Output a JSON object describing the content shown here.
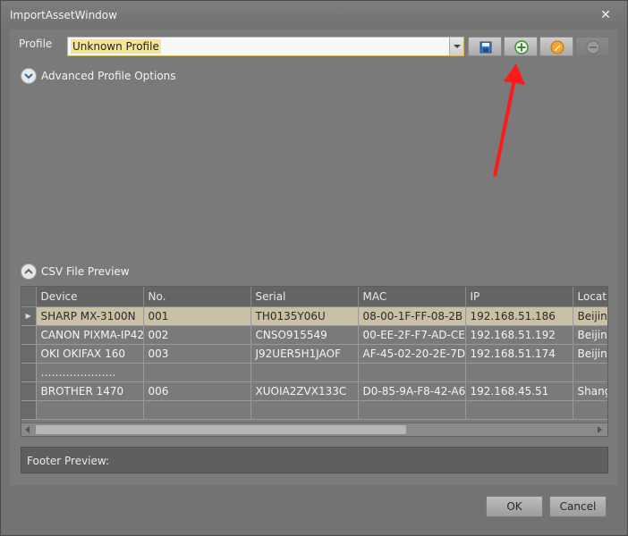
{
  "window": {
    "title": "ImportAssetWindow"
  },
  "profile": {
    "label": "Profile",
    "selected": "Unknown Profile",
    "buttons": [
      "save-icon",
      "add-icon",
      "edit-icon",
      "remove-icon"
    ]
  },
  "advanced": {
    "label": "Advanced Profile Options"
  },
  "csv": {
    "label": "CSV File Preview",
    "columns": [
      "Device",
      "No.",
      "Serial",
      "MAC",
      "IP",
      "Location"
    ],
    "rows": [
      [
        "SHARP MX-3100N",
        "001",
        "TH0135Y06U",
        "08-00-1F-FF-08-2B",
        "192.168.51.186",
        "Beijing"
      ],
      [
        "CANON PIXMA-IP42",
        "002",
        "CNSO915549",
        "00-EE-2F-F7-AD-CE",
        "192.168.51.192",
        "Beijing"
      ],
      [
        "OKI OKIFAX 160",
        "003",
        "J92UER5H1JAOF",
        "AF-45-02-20-2E-7D",
        "192.168.51.174",
        "Beijing"
      ],
      [
        "…………………",
        "",
        "",
        "",
        "",
        ""
      ],
      [
        "BROTHER 1470",
        "006",
        "XUOIA2ZVX133C",
        "D0-85-9A-F8-42-A6",
        "192.168.45.51",
        "Shanghai"
      ],
      [
        "",
        "",
        "",
        "",
        "",
        ""
      ]
    ]
  },
  "footer": {
    "label": "Footer Preview:"
  },
  "dialog": {
    "ok": "OK",
    "cancel": "Cancel"
  },
  "colors": {
    "accent_arrow": "#ff1a1a"
  }
}
